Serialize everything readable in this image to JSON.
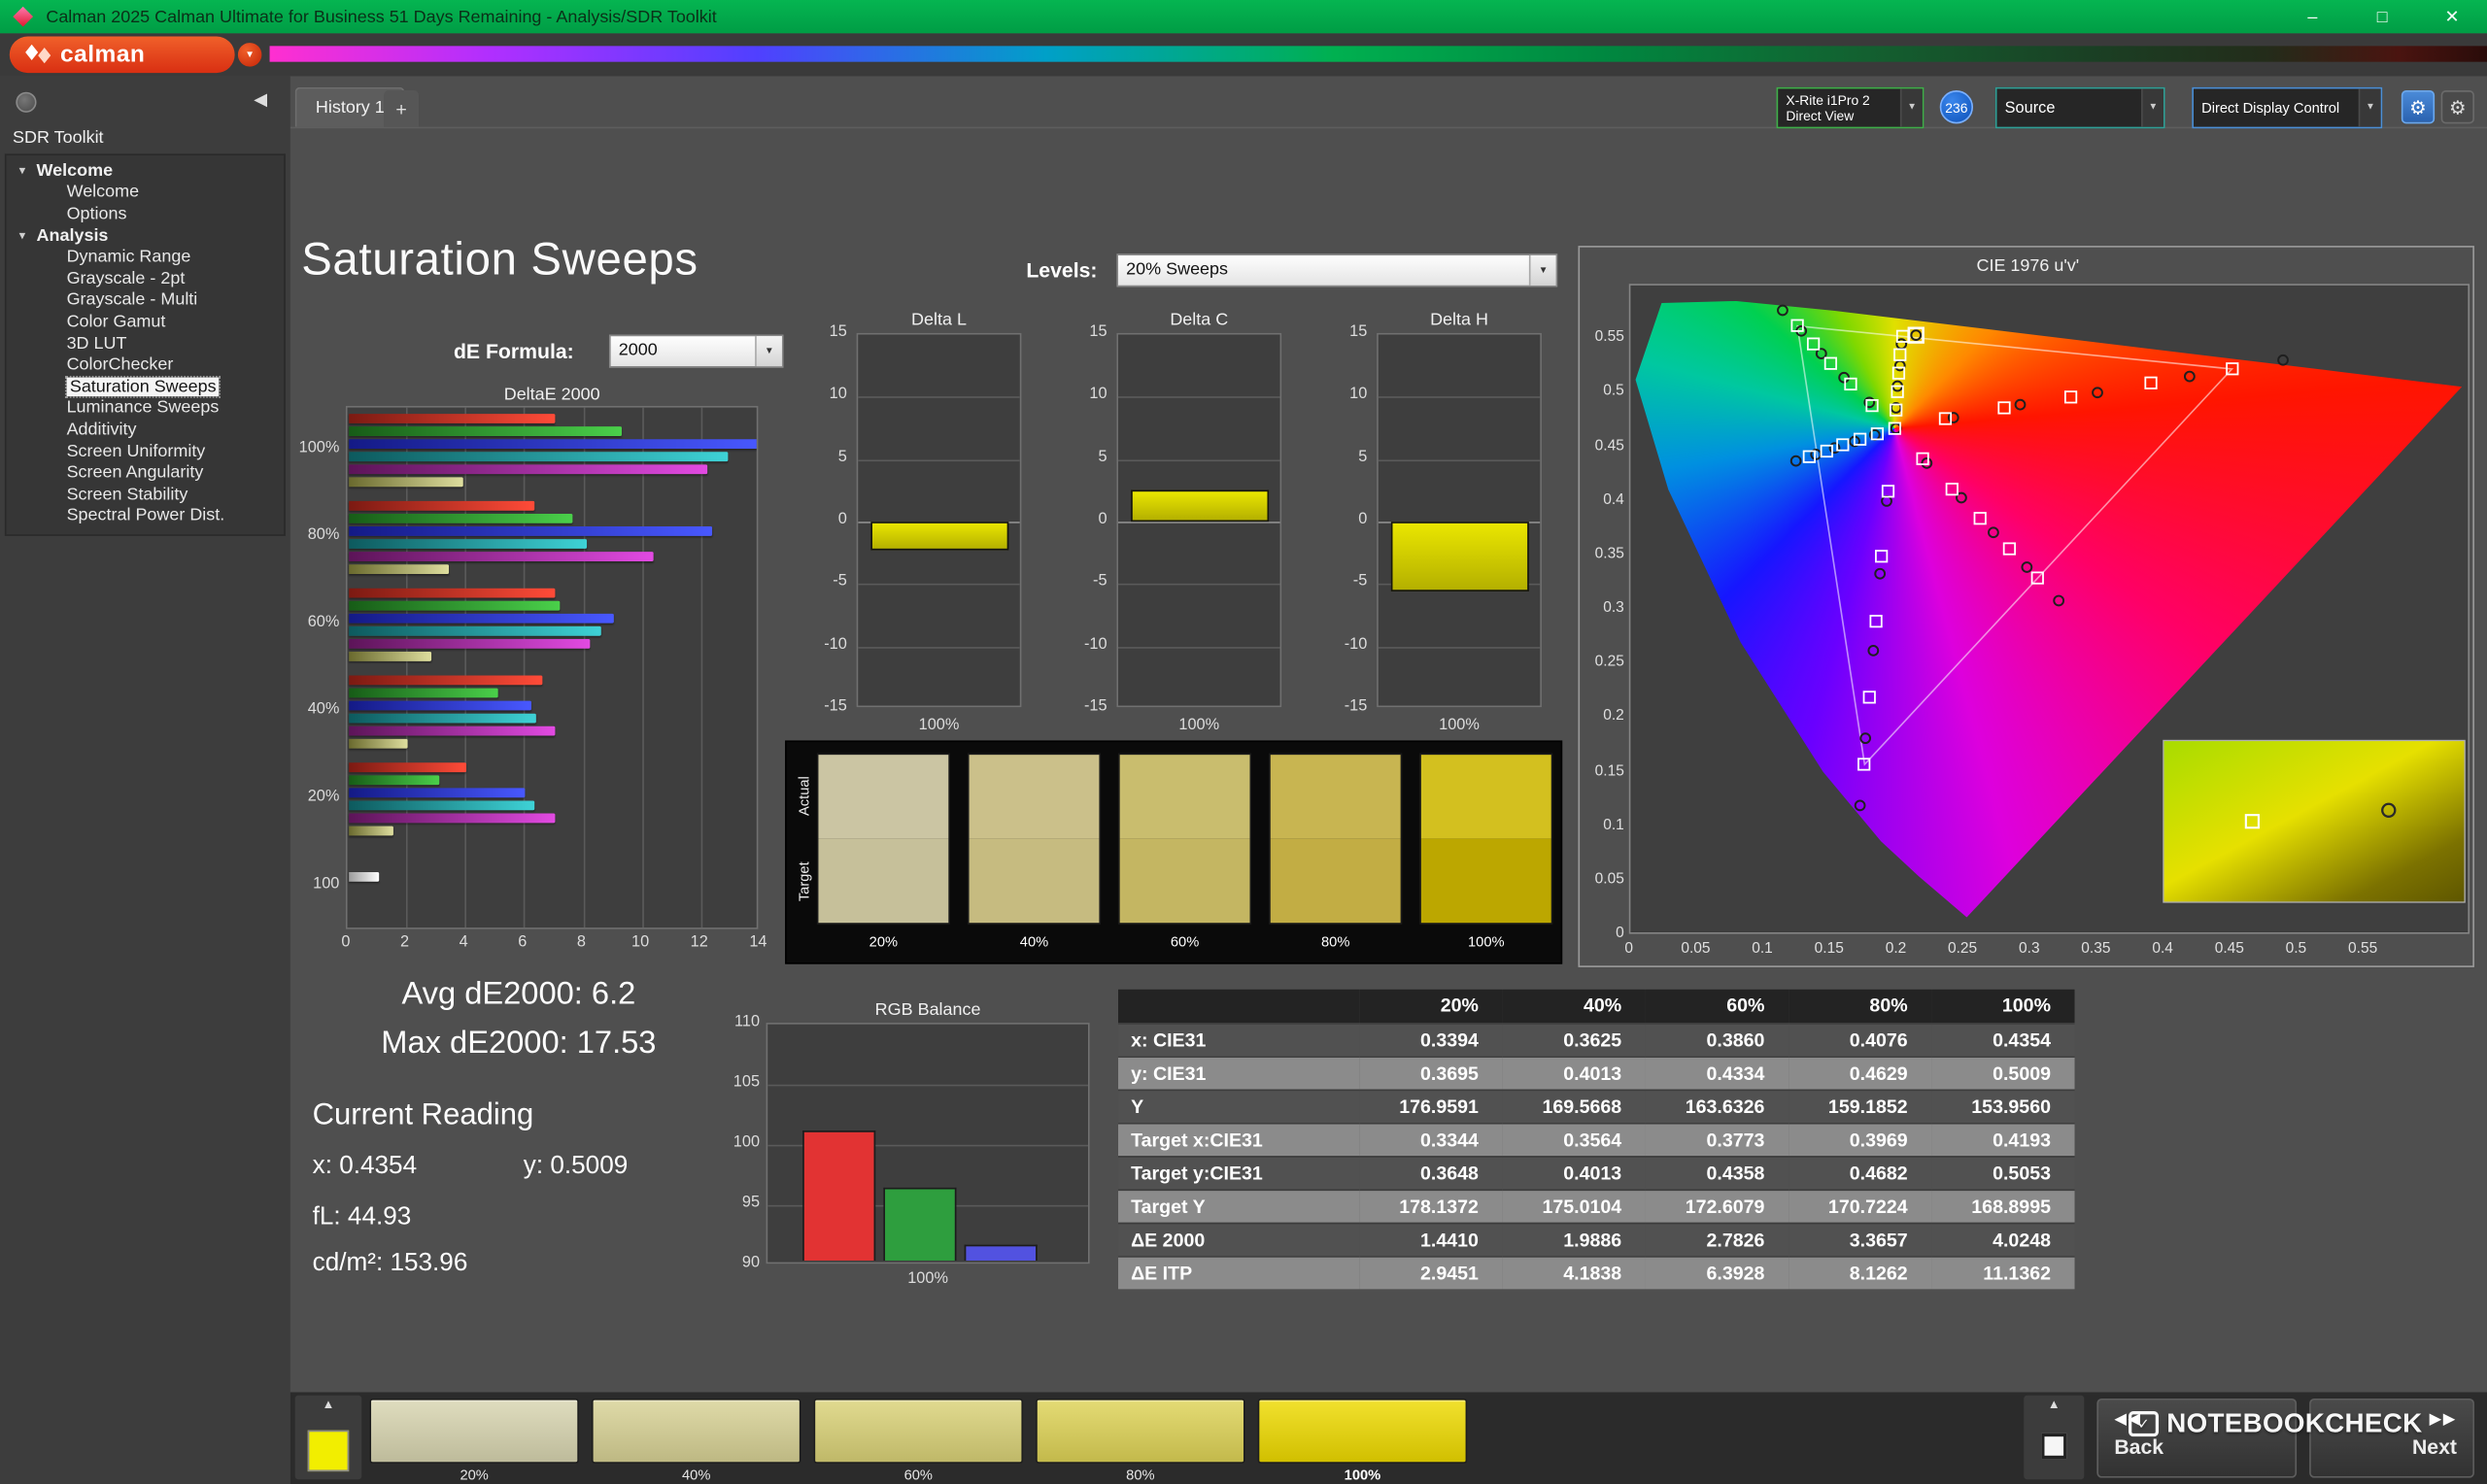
{
  "icons": {
    "dropdown": "▼",
    "tree_expanded": "▾",
    "collapse_sidebar": "◀",
    "eject": "▲",
    "gear": "⚙",
    "add_tab": "+",
    "minimize": "–",
    "maximize": "□",
    "close": "✕",
    "back_arrows": "◀◀",
    "next_arrows": "▶▶",
    "check": "✓"
  },
  "window": {
    "title": "Calman 2025 Calman Ultimate for Business 51 Days Remaining  - Analysis/SDR Toolkit",
    "logo_text": "calman"
  },
  "tabs": {
    "history": "History 1"
  },
  "toolbar": {
    "meter_line1": "X-Rite i1Pro 2",
    "meter_line2": "Direct View",
    "meter_badge": "236",
    "source_label": "Source",
    "display_control_label": "Direct Display Control"
  },
  "sidebar": {
    "title": "SDR Toolkit",
    "selected": "Saturation Sweeps",
    "tree": [
      {
        "label": "Welcome",
        "children": [
          "Welcome",
          "Options"
        ]
      },
      {
        "label": "Analysis",
        "children": [
          "Dynamic Range",
          "Grayscale - 2pt",
          "Grayscale - Multi",
          "Color Gamut",
          "3D LUT",
          "ColorChecker",
          "Saturation Sweeps",
          "Luminance Sweeps",
          "Additivity",
          "Screen Uniformity",
          "Screen Angularity",
          "Screen Stability",
          "Spectral Power Dist."
        ]
      }
    ]
  },
  "page": {
    "title": "Saturation Sweeps",
    "de_formula_label": "dE Formula:",
    "de_formula_value": "2000",
    "levels_label": "Levels:",
    "levels_value": "20% Sweeps",
    "avg_de": "Avg dE2000: 6.2",
    "max_de": "Max dE2000: 17.53",
    "current_reading_title": "Current Reading",
    "reading_x": "x: 0.4354",
    "reading_y": "y: 0.5009",
    "reading_fl": "fL: 44.93",
    "reading_cd": "cd/m²: 153.96"
  },
  "swatch_compare": {
    "row_labels": [
      "Actual",
      "Target"
    ],
    "levels": [
      "20%",
      "40%",
      "60%",
      "80%",
      "100%"
    ],
    "actual": [
      "#cbc5a3",
      "#cbc08a",
      "#c9bd6e",
      "#c8b551",
      "#d3c01f"
    ],
    "target": [
      "#c6c09a",
      "#c6bb80",
      "#c4b662",
      "#c2ad44",
      "#bca700"
    ]
  },
  "footer": {
    "back": "Back",
    "next": "Next",
    "watermark": "NOTEBOOKCHECK",
    "swatches": {
      "levels": [
        "20%",
        "40%",
        "60%",
        "80%",
        "100%"
      ],
      "colors": [
        "#d8d5b0",
        "#d8d295",
        "#dad277",
        "#ded356",
        "#eeda00"
      ],
      "selected": "100%",
      "chip_color": "#f2ee00"
    }
  },
  "chart_data": [
    {
      "id": "deltae2000",
      "type": "bar",
      "orientation": "horizontal",
      "title": "DeltaE 2000",
      "groups": [
        "100%",
        "80%",
        "60%",
        "40%",
        "20%",
        "100"
      ],
      "series": [
        "red",
        "green",
        "blue",
        "cyan",
        "magenta",
        "yellow"
      ],
      "values": [
        [
          7.0,
          9.3,
          14.0,
          12.9,
          12.2,
          3.9
        ],
        [
          6.3,
          7.6,
          12.4,
          8.1,
          10.4,
          3.4
        ],
        [
          7.0,
          7.2,
          9.0,
          8.6,
          8.2,
          2.8
        ],
        [
          6.6,
          5.1,
          6.2,
          6.4,
          7.0,
          2.0
        ],
        [
          4.0,
          3.1,
          6.0,
          6.3,
          7.0,
          1.5
        ],
        [
          1.0
        ]
      ],
      "xlim": [
        0,
        14
      ],
      "xticks": [
        0,
        2,
        4,
        6,
        8,
        10,
        12,
        14
      ]
    },
    {
      "id": "delta_l",
      "type": "bar",
      "title": "Delta L",
      "categories": [
        "100%"
      ],
      "values": [
        -2.3
      ],
      "ylim": [
        -15,
        15
      ],
      "yticks": [
        15,
        10,
        5,
        0,
        -5,
        -10,
        -15
      ],
      "color": "#d8d400"
    },
    {
      "id": "delta_c",
      "type": "bar",
      "title": "Delta C",
      "categories": [
        "100%"
      ],
      "values": [
        2.6
      ],
      "ylim": [
        -15,
        15
      ],
      "yticks": [
        15,
        10,
        5,
        0,
        -5,
        -10,
        -15
      ],
      "color": "#d8d400"
    },
    {
      "id": "delta_h",
      "type": "bar",
      "title": "Delta H",
      "categories": [
        "100%"
      ],
      "values": [
        -5.6
      ],
      "ylim": [
        -15,
        15
      ],
      "yticks": [
        15,
        10,
        5,
        0,
        -5,
        -10,
        -15
      ],
      "color": "#d8d400"
    },
    {
      "id": "rgb_balance",
      "type": "bar",
      "title": "RGB Balance",
      "categories": [
        "100%"
      ],
      "series": [
        {
          "name": "Red",
          "value": 101.0,
          "color": "#e23333"
        },
        {
          "name": "Green",
          "value": 96.2,
          "color": "#2e9e3e"
        },
        {
          "name": "Blue",
          "value": 91.3,
          "color": "#5252e0"
        }
      ],
      "ylim": [
        90,
        110
      ],
      "yticks": [
        110,
        105,
        100,
        95,
        90
      ]
    },
    {
      "id": "cie",
      "type": "scatter",
      "title": "CIE 1976 u'v'",
      "xlim": [
        0,
        0.63
      ],
      "ylim": [
        0,
        0.6
      ],
      "xticks": [
        0,
        0.05,
        0.1,
        0.15,
        0.2,
        0.25,
        0.3,
        0.35,
        0.4,
        0.45,
        0.5,
        0.55
      ],
      "yticks": [
        0,
        0.05,
        0.1,
        0.15,
        0.2,
        0.25,
        0.3,
        0.35,
        0.4,
        0.45,
        0.5,
        0.55
      ],
      "gamut_triangle": [
        [
          0.4507,
          0.5229
        ],
        [
          0.125,
          0.5625
        ],
        [
          0.1754,
          0.1579
        ]
      ],
      "targets": [
        [
          0.198,
          0.468
        ],
        [
          0.236,
          0.477
        ],
        [
          0.28,
          0.487
        ],
        [
          0.33,
          0.497
        ],
        [
          0.39,
          0.51
        ],
        [
          0.451,
          0.523
        ],
        [
          0.181,
          0.489
        ],
        [
          0.165,
          0.509
        ],
        [
          0.15,
          0.528
        ],
        [
          0.137,
          0.546
        ],
        [
          0.125,
          0.563
        ],
        [
          0.193,
          0.41
        ],
        [
          0.188,
          0.35
        ],
        [
          0.184,
          0.29
        ],
        [
          0.179,
          0.22
        ],
        [
          0.175,
          0.158
        ],
        [
          0.185,
          0.463
        ],
        [
          0.172,
          0.458
        ],
        [
          0.159,
          0.453
        ],
        [
          0.147,
          0.447
        ],
        [
          0.134,
          0.442
        ],
        [
          0.219,
          0.44
        ],
        [
          0.241,
          0.412
        ],
        [
          0.262,
          0.385
        ],
        [
          0.284,
          0.357
        ],
        [
          0.305,
          0.33
        ],
        [
          0.199,
          0.485
        ],
        [
          0.2,
          0.502
        ],
        [
          0.201,
          0.519
        ],
        [
          0.202,
          0.536
        ],
        [
          0.204,
          0.553
        ]
      ],
      "measured": [
        [
          0.199,
          0.468
        ],
        [
          0.242,
          0.478
        ],
        [
          0.292,
          0.49
        ],
        [
          0.35,
          0.501
        ],
        [
          0.419,
          0.516
        ],
        [
          0.489,
          0.531
        ],
        [
          0.179,
          0.492
        ],
        [
          0.16,
          0.515
        ],
        [
          0.143,
          0.537
        ],
        [
          0.128,
          0.558
        ],
        [
          0.114,
          0.577
        ],
        [
          0.192,
          0.401
        ],
        [
          0.187,
          0.334
        ],
        [
          0.182,
          0.263
        ],
        [
          0.176,
          0.182
        ],
        [
          0.172,
          0.12
        ],
        [
          0.183,
          0.462
        ],
        [
          0.168,
          0.456
        ],
        [
          0.153,
          0.45
        ],
        [
          0.139,
          0.444
        ],
        [
          0.124,
          0.438
        ],
        [
          0.222,
          0.436
        ],
        [
          0.248,
          0.404
        ],
        [
          0.272,
          0.372
        ],
        [
          0.297,
          0.34
        ],
        [
          0.321,
          0.309
        ],
        [
          0.199,
          0.487
        ],
        [
          0.2,
          0.507
        ],
        [
          0.202,
          0.526
        ],
        [
          0.203,
          0.546
        ],
        [
          0.214,
          0.554
        ]
      ],
      "current": [
        0.214,
        0.554
      ]
    },
    {
      "id": "saturation_table",
      "type": "table",
      "columns": [
        "",
        "20%",
        "40%",
        "60%",
        "80%",
        "100%"
      ],
      "rows": [
        [
          "x: CIE31",
          "0.3394",
          "0.3625",
          "0.3860",
          "0.4076",
          "0.4354"
        ],
        [
          "y: CIE31",
          "0.3695",
          "0.4013",
          "0.4334",
          "0.4629",
          "0.5009"
        ],
        [
          "Y",
          "176.9591",
          "169.5668",
          "163.6326",
          "159.1852",
          "153.9560"
        ],
        [
          "Target x:CIE31",
          "0.3344",
          "0.3564",
          "0.3773",
          "0.3969",
          "0.4193"
        ],
        [
          "Target y:CIE31",
          "0.3648",
          "0.4013",
          "0.4358",
          "0.4682",
          "0.5053"
        ],
        [
          "Target Y",
          "178.1372",
          "175.0104",
          "172.6079",
          "170.7224",
          "168.8995"
        ],
        [
          "ΔE 2000",
          "1.4410",
          "1.9886",
          "2.7826",
          "3.3657",
          "4.0248"
        ],
        [
          "ΔE ITP",
          "2.9451",
          "4.1838",
          "6.3928",
          "8.1262",
          "11.1362"
        ]
      ]
    }
  ]
}
